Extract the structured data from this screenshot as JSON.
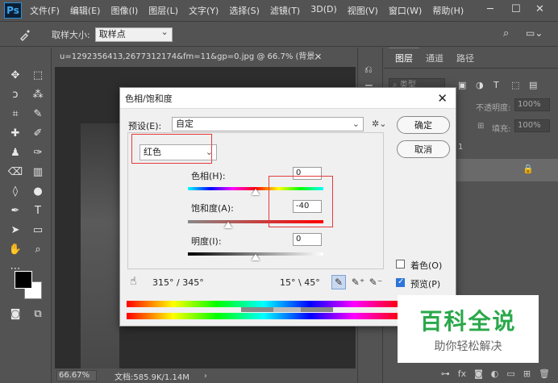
{
  "app": {
    "logo": "Ps"
  },
  "menubar": {
    "items": [
      "文件(F)",
      "编辑(E)",
      "图像(I)",
      "图层(L)",
      "文字(Y)",
      "选择(S)",
      "滤镜(T)",
      "3D(D)",
      "视图(V)",
      "窗口(W)",
      "帮助(H)"
    ]
  },
  "optbar": {
    "sample_label": "取样大小:",
    "sample_value": "取样点"
  },
  "document": {
    "tab_title": "u=1292356413,2677312174&fm=11&gp=0.jpg @ 66.7% (背景,",
    "zoom": "66.67%",
    "doc_info": "文档:585.9K/1.14M"
  },
  "panel": {
    "tabs": [
      "图层",
      "通道",
      "路径"
    ],
    "kind_label": "类型",
    "opacity_label": "不透明度:",
    "opacity_value": "100%",
    "fill_label": "填充:",
    "fill_value": "100%",
    "layer_number": "1"
  },
  "dialog": {
    "title": "色相/饱和度",
    "preset_label": "预设(E):",
    "preset_value": "自定",
    "channel_value": "红色",
    "hue_label": "色相(H):",
    "hue_value": "0",
    "saturation_label": "饱和度(A):",
    "saturation_value": "-40",
    "lightness_label": "明度(I):",
    "lightness_value": "0",
    "ok_label": "确定",
    "cancel_label": "取消",
    "colorize_label": "着色(O)",
    "preview_label": "预览(P)",
    "range_left": "315° / 345°",
    "range_right": "15° \\ 45°",
    "slider_levels": {
      "hue": 0,
      "saturation": -40,
      "lightness": 0
    }
  },
  "watermark": {
    "main": "百科全说",
    "sub": "助你轻松解决"
  },
  "colors": {
    "highlight": "#e23b3b",
    "watermark_green": "#2aa84a"
  }
}
